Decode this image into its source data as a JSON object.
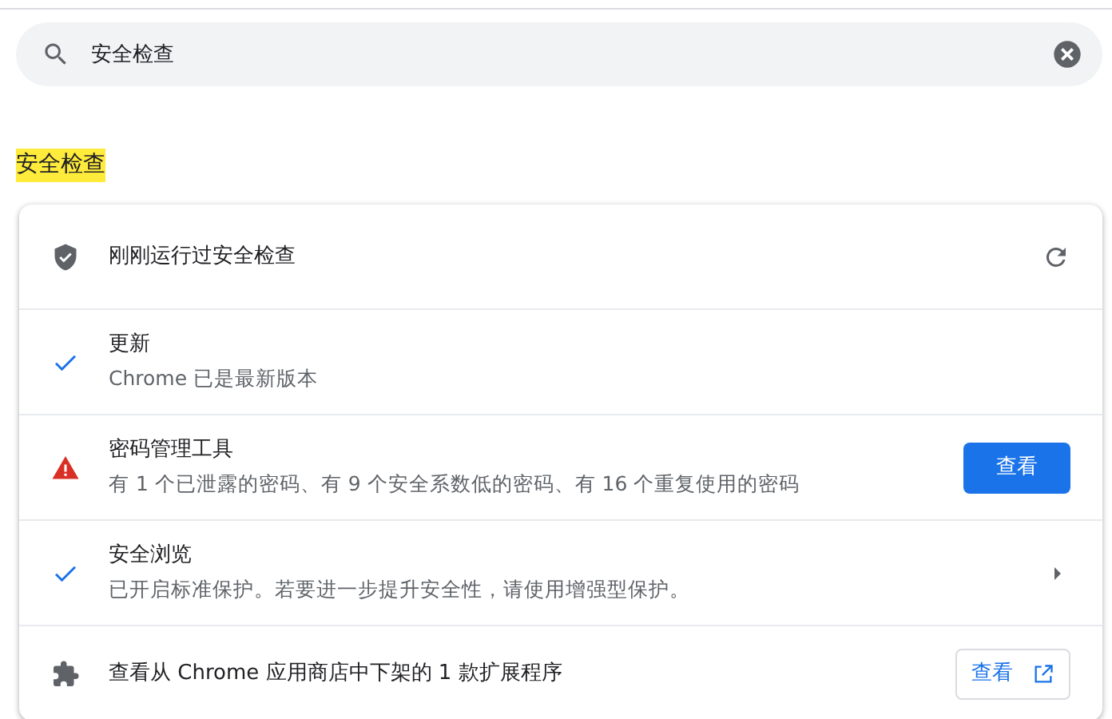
{
  "search": {
    "value": "安全检查"
  },
  "section_title": {
    "text": "安全检查",
    "highlighted": true
  },
  "rows": [
    {
      "kind": "header",
      "title": "刚刚运行过安全检查",
      "action": {
        "kind": "refresh"
      }
    },
    {
      "kind": "ok",
      "title": "更新",
      "subtitle": "Chrome 已是最新版本"
    },
    {
      "kind": "warning",
      "title": "密码管理工具",
      "subtitle": "有 1 个已泄露的密码、有 9 个安全系数低的密码、有 16 个重复使用的密码",
      "action": {
        "kind": "primary",
        "label": "查看"
      }
    },
    {
      "kind": "ok",
      "title": "安全浏览",
      "subtitle": "已开启标准保护。若要进一步提升安全性，请使用增强型保护。",
      "action": {
        "kind": "arrow"
      }
    },
    {
      "kind": "extension",
      "title": "查看从 Chrome 应用商店中下架的 1 款扩展程序",
      "action": {
        "kind": "external",
        "label": "查看"
      }
    }
  ]
}
